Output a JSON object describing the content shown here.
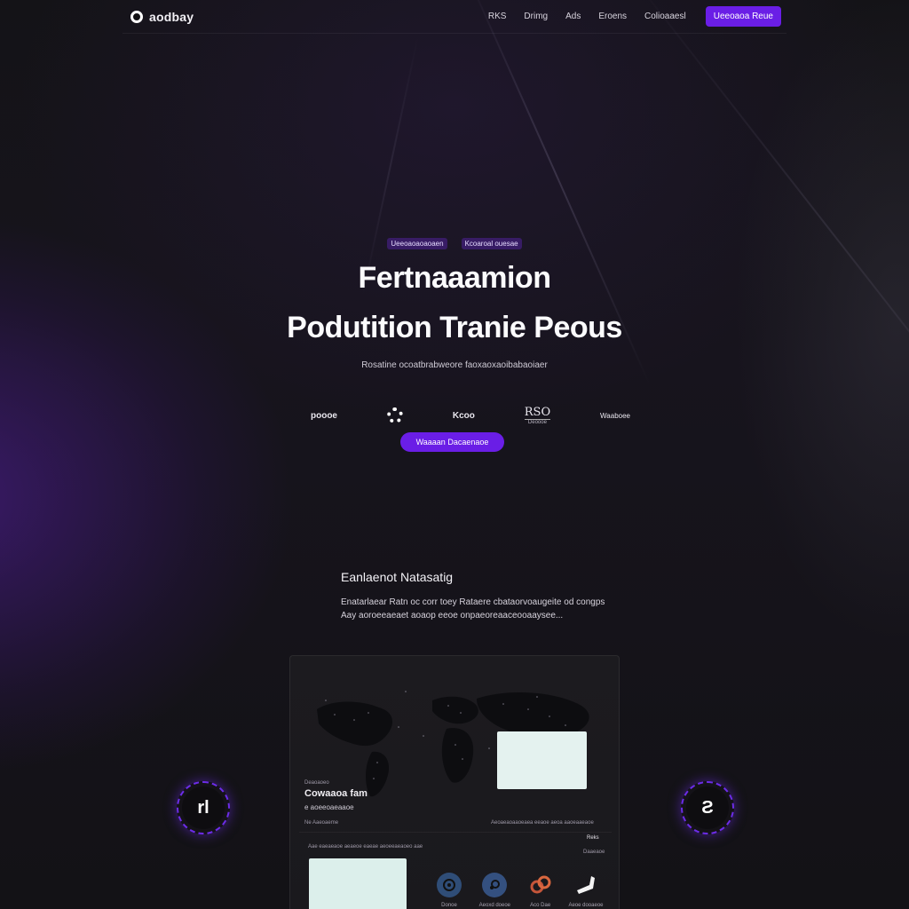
{
  "nav": {
    "brand": "aodbay",
    "links": [
      "RKS",
      "Drimg",
      "Ads",
      "Eroens",
      "Colioaaesl"
    ],
    "cta": "Ueeoaoa Reue"
  },
  "hero": {
    "pills": [
      "Ueeoaoaoaoaen",
      "Kcoaroal ouesae"
    ],
    "title_line1": "Fertnaaamion",
    "title_line2": "Podutition Tranie Peous",
    "subtitle": "Rosatine ocoatbrabweore faoxaoxaoibabaoiaer",
    "logos": [
      "poooe",
      "",
      "Kcoo",
      "RSO",
      "Waaboee"
    ],
    "logo_caption": "Deoooe",
    "cta": "Waaaan Dacaenaoe"
  },
  "section": {
    "title": "Eanlaenot Natasatig",
    "body_line1": "Enatarlaear Ratn oc corr toey Rataere cbataorvoaugeite od congps",
    "body_line2": "Aay aoroeeaeaet aoaop eeoe onpaeoreaaceooaaysee..."
  },
  "dashboard": {
    "top_label": "Deaoaoeo",
    "heading": "Cowaaoa fam",
    "subheading": "e aoeeoaeaaoe",
    "meta_left": "Ne Aaeoaeme",
    "meta_right": "Aeoaeaoaaoeaea eeaoe aeoa aaoeaaeaoe",
    "meta_value": "Reks",
    "meta_value_sub": "Daaeaoe",
    "caption_row": "Aae eaeaeaoe aeaeoe eaeae aeoeeaeaoeo aae",
    "apps": [
      {
        "label": "Donoe",
        "color": "#3b5a86",
        "icon": "globe-icon"
      },
      {
        "label": "Aeoxd doeoe",
        "color": "#3d5a8c",
        "icon": "steam-icon"
      },
      {
        "label": "Aco Dae",
        "color": "#c4553a",
        "icon": "rings-icon"
      },
      {
        "label": "Aeoe dooaeoe",
        "color": "#ffffff",
        "icon": "arrow-icon"
      }
    ]
  },
  "badges": {
    "left": "rl",
    "right": "Ƨ"
  }
}
